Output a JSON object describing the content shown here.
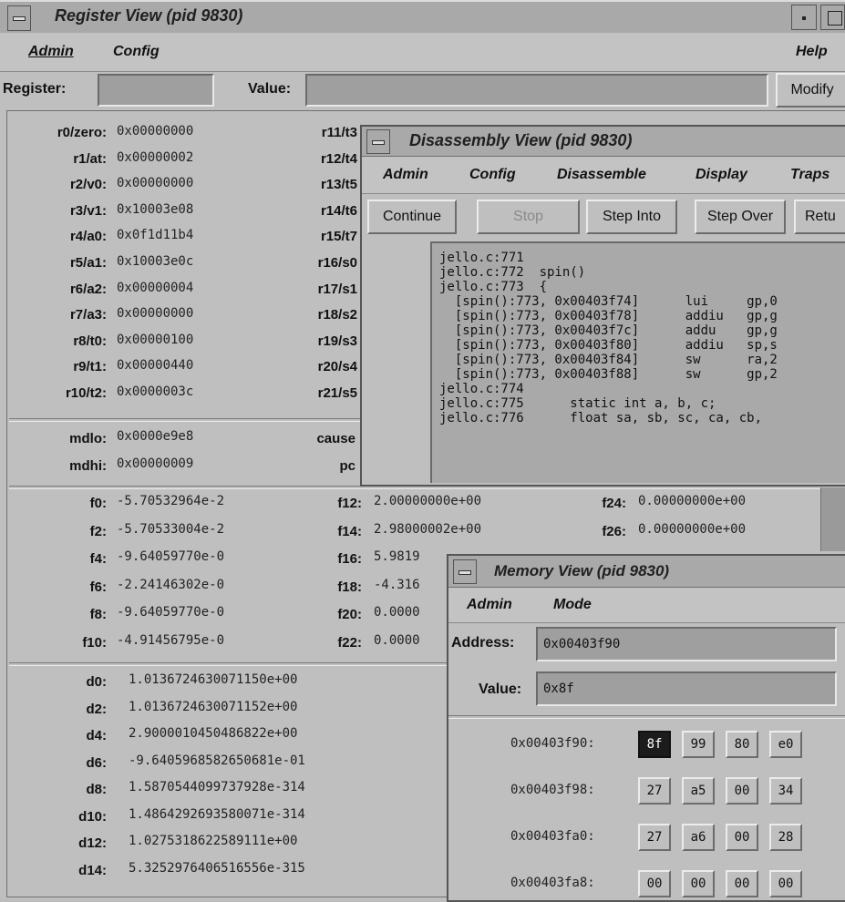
{
  "register_window": {
    "title": "Register View (pid 9830)",
    "menus": {
      "admin": "Admin",
      "config": "Config",
      "help": "Help"
    },
    "register_label": "Register:",
    "value_label": "Value:",
    "register_value": "",
    "value_value": "",
    "modify_label": "Modify",
    "gpr_col1": [
      {
        "name": "r0/zero:",
        "value": "0x00000000"
      },
      {
        "name": "r1/at:",
        "value": "0x00000002"
      },
      {
        "name": "r2/v0:",
        "value": "0x00000000"
      },
      {
        "name": "r3/v1:",
        "value": "0x10003e08"
      },
      {
        "name": "r4/a0:",
        "value": "0x0f1d11b4"
      },
      {
        "name": "r5/a1:",
        "value": "0x10003e0c"
      },
      {
        "name": "r6/a2:",
        "value": "0x00000004"
      },
      {
        "name": "r7/a3:",
        "value": "0x00000000"
      },
      {
        "name": "r8/t0:",
        "value": "0x00000100"
      },
      {
        "name": "r9/t1:",
        "value": "0x00000440"
      },
      {
        "name": "r10/t2:",
        "value": "0x0000003c"
      }
    ],
    "gpr_col2": [
      "r11/t3",
      "r12/t4",
      "r13/t5",
      "r14/t6",
      "r15/t7",
      "r16/s0",
      "r17/s1",
      "r18/s2",
      "r19/s3",
      "r20/s4",
      "r21/s5"
    ],
    "special": [
      {
        "name": "mdlo:",
        "value": "0x0000e9e8",
        "name2": "cause"
      },
      {
        "name": "mdhi:",
        "value": "0x00000009",
        "name2": "pc"
      }
    ],
    "fpr_col1": [
      {
        "name": "f0:",
        "value": "-5.70532964e-2"
      },
      {
        "name": "f2:",
        "value": "-5.70533004e-2"
      },
      {
        "name": "f4:",
        "value": "-9.64059770e-0"
      },
      {
        "name": "f6:",
        "value": "-2.24146302e-0"
      },
      {
        "name": "f8:",
        "value": "-9.64059770e-0"
      },
      {
        "name": "f10:",
        "value": "-4.91456795e-0"
      }
    ],
    "fpr_col2": [
      {
        "name": "f12:",
        "value": "2.00000000e+00"
      },
      {
        "name": "f14:",
        "value": "2.98000002e+00"
      },
      {
        "name": "f16:",
        "value": "5.9819"
      },
      {
        "name": "f18:",
        "value": "-4.316"
      },
      {
        "name": "f20:",
        "value": "0.0000"
      },
      {
        "name": "f22:",
        "value": "0.0000"
      }
    ],
    "fpr_col3": [
      {
        "name": "f24:",
        "value": "0.00000000e+00"
      },
      {
        "name": "f26:",
        "value": "0.00000000e+00"
      }
    ],
    "dpr": [
      {
        "name": "d0:",
        "value": "1.0136724630071150e+00"
      },
      {
        "name": "d2:",
        "value": "1.0136724630071152e+00"
      },
      {
        "name": "d4:",
        "value": "2.9000010450486822e+00"
      },
      {
        "name": "d6:",
        "value": "-9.6405968582650681e-01"
      },
      {
        "name": "d8:",
        "value": "1.5870544099737928e-314"
      },
      {
        "name": "d10:",
        "value": "1.4864292693580071e-314"
      },
      {
        "name": "d12:",
        "value": "1.0275318622589111e+00"
      },
      {
        "name": "d14:",
        "value": "5.3252976406516556e-315"
      }
    ]
  },
  "disassembly_window": {
    "title": "Disassembly View (pid 9830)",
    "menus": {
      "admin": "Admin",
      "config": "Config",
      "disassemble": "Disassemble",
      "display": "Display",
      "traps": "Traps"
    },
    "buttons": {
      "continue": "Continue",
      "stop": "Stop",
      "step_into": "Step Into",
      "step_over": "Step Over",
      "return": "Retu"
    },
    "lines": [
      "jello.c:771",
      "jello.c:772  spin()",
      "jello.c:773  {",
      "  [spin():773, 0x00403f74]      lui     gp,0",
      "  [spin():773, 0x00403f78]      addiu   gp,g",
      "  [spin():773, 0x00403f7c]      addu    gp,g",
      "  [spin():773, 0x00403f80]      addiu   sp,s",
      "  [spin():773, 0x00403f84]      sw      ra,2",
      "  [spin():773, 0x00403f88]      sw      gp,2",
      "jello.c:774",
      "jello.c:775      static int a, b, c;",
      "jello.c:776      float sa, sb, sc, ca, cb,"
    ]
  },
  "memory_window": {
    "title": "Memory View (pid 9830)",
    "menus": {
      "admin": "Admin",
      "mode": "Mode"
    },
    "address_label": "Address:",
    "address_value": "0x00403f90",
    "value_label": "Value:",
    "value_value": "0x8f",
    "rows": [
      {
        "addr": "0x00403f90:",
        "bytes": [
          "8f",
          "99",
          "80",
          "e0"
        ]
      },
      {
        "addr": "0x00403f98:",
        "bytes": [
          "27",
          "a5",
          "00",
          "34"
        ]
      },
      {
        "addr": "0x00403fa0:",
        "bytes": [
          "27",
          "a6",
          "00",
          "28"
        ]
      },
      {
        "addr": "0x00403fa8:",
        "bytes": [
          "00",
          "00",
          "00",
          "00"
        ]
      }
    ]
  }
}
